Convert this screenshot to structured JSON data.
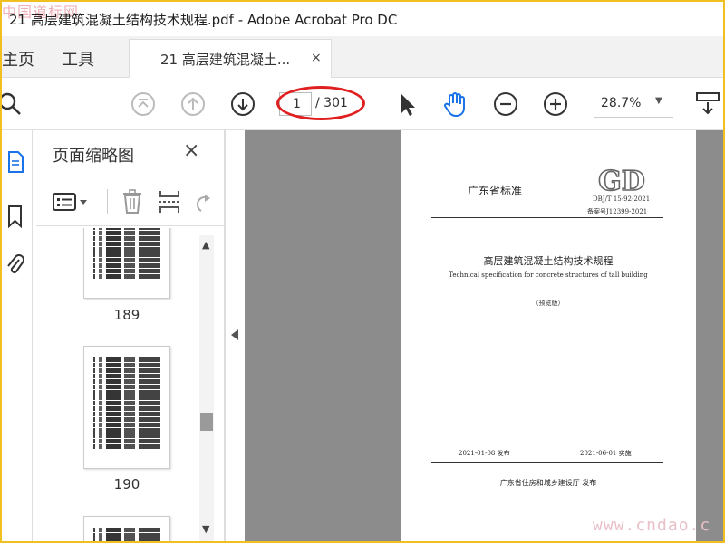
{
  "window": {
    "title": "21 高层建筑混凝土结构技术规程.pdf - Adobe Acrobat Pro DC"
  },
  "watermarks": {
    "top": "中国道标网",
    "bottom": "www.cndao.c"
  },
  "tabs": {
    "home": "主页",
    "tools": "工具",
    "doc": "21 高层建筑混凝土...",
    "doc_close": "×"
  },
  "toolbar": {
    "icons": [
      "zoom-search-icon",
      "first-page-icon",
      "previous-page-icon",
      "next-page-icon",
      "select-pointer-icon",
      "hand-tool-icon",
      "zoom-out-icon",
      "zoom-in-icon",
      "more-tools-icon"
    ],
    "current_page": "1",
    "total_pages": "/ 301",
    "zoom": "28.7%"
  },
  "rail": {
    "icons": [
      "page-thumbnails-icon",
      "bookmark-icon",
      "attachments-icon"
    ]
  },
  "thumbnail_panel": {
    "title": "页面缩略图",
    "close": "×",
    "tools": [
      "options-menu-icon",
      "delete-page-icon",
      "insert-page-icon",
      "rotate-page-icon"
    ],
    "pages": [
      {
        "number": "189"
      },
      {
        "number": "190"
      }
    ]
  },
  "document_page": {
    "standard": "广东省标准",
    "logo_text": "GD",
    "code": "DBJ/T 15-92-2021",
    "record": "备案号J12399-2021",
    "title_cn": "高层建筑混凝土结构技术规程",
    "title_en": "Technical specification for concrete structures of tall building",
    "preview": "（预览版）",
    "issue": "2021-01-08   发布",
    "implement": "2021-06-01   实施",
    "publisher": "广东省住房和城乡建设厅   发布"
  },
  "colors": {
    "annotation_oval": "#e02020",
    "hand_tool_active": "#1a73e8",
    "doc_background": "#8c8c8c"
  }
}
